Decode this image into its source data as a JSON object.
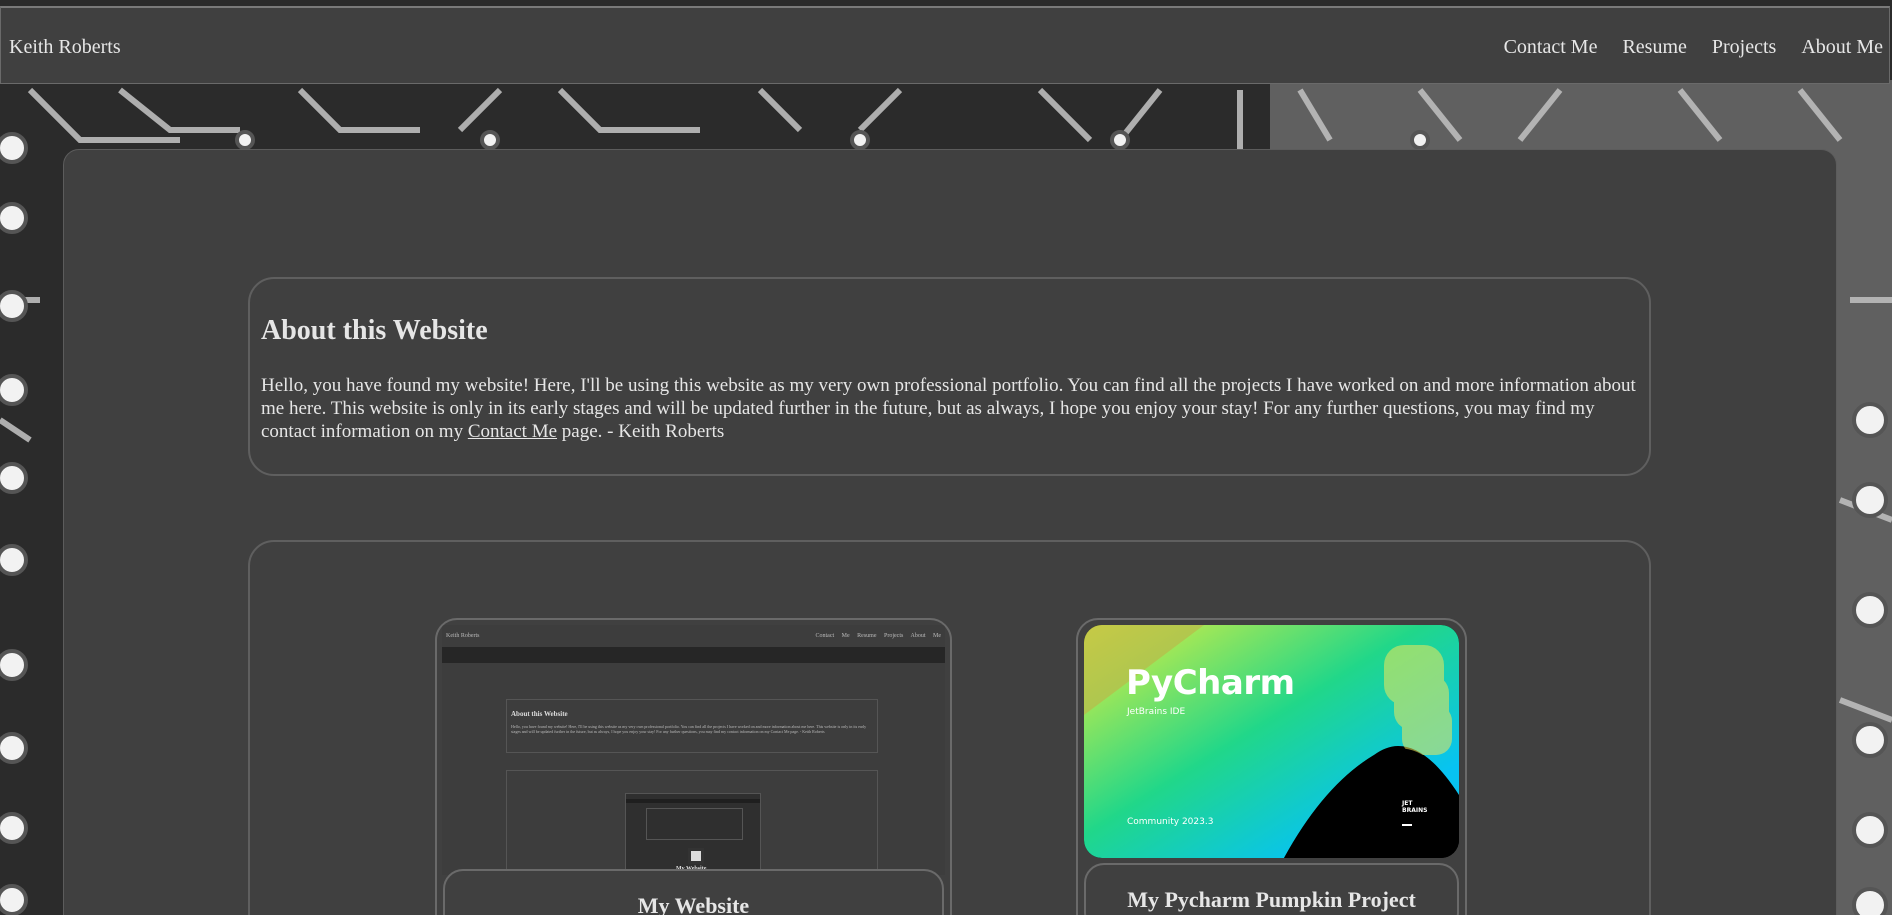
{
  "navbar": {
    "brand": "Keith Roberts",
    "links": [
      "Contact Me",
      "Resume",
      "Projects",
      "About Me"
    ]
  },
  "about": {
    "title": "About this Website",
    "body_before_link": "Hello, you have found my website! Here, I'll be using this website as my very own professional portfolio. You can find all the projects I have worked on and more information about me here. This website is only in its early stages and will be updated further in the future, but as always, I hope you enjoy your stay! For any further questions, you may find my contact information on my ",
    "link_text": "Contact Me",
    "body_after_link": " page. - Keith Roberts"
  },
  "projects": [
    {
      "title": "My Website",
      "thumbnail": {
        "brand": "Keith Roberts",
        "links": "Contact Me Resume Projects About Me",
        "about_title": "About this Website",
        "about_text": "Hello, you have found my website! Here, I'll be using this website as my very own professional portfolio. You can find all the projects I have worked on and more information about me here. This website is only in its early stages and will be updated further in the future, but as always, I hope you enjoy your stay! For any further questions, you may find my contact information on my Contact Me page. - Keith Roberts",
        "inner_label": "My Website"
      }
    },
    {
      "title": "My Pycharm Pumpkin Project",
      "thumbnail": {
        "product": "PyCharm",
        "subtitle": "JetBrains IDE",
        "edition": "Community 2023.3",
        "maker_line1": "JET",
        "maker_line2": "BRAINS"
      }
    }
  ],
  "colors": {
    "panel": "#404040",
    "border": "#6a6a6a",
    "text": "#e6e6e6",
    "pycharm_yellow": "#e6f03c",
    "pycharm_green": "#21d789",
    "pycharm_blue": "#07c3f2"
  }
}
